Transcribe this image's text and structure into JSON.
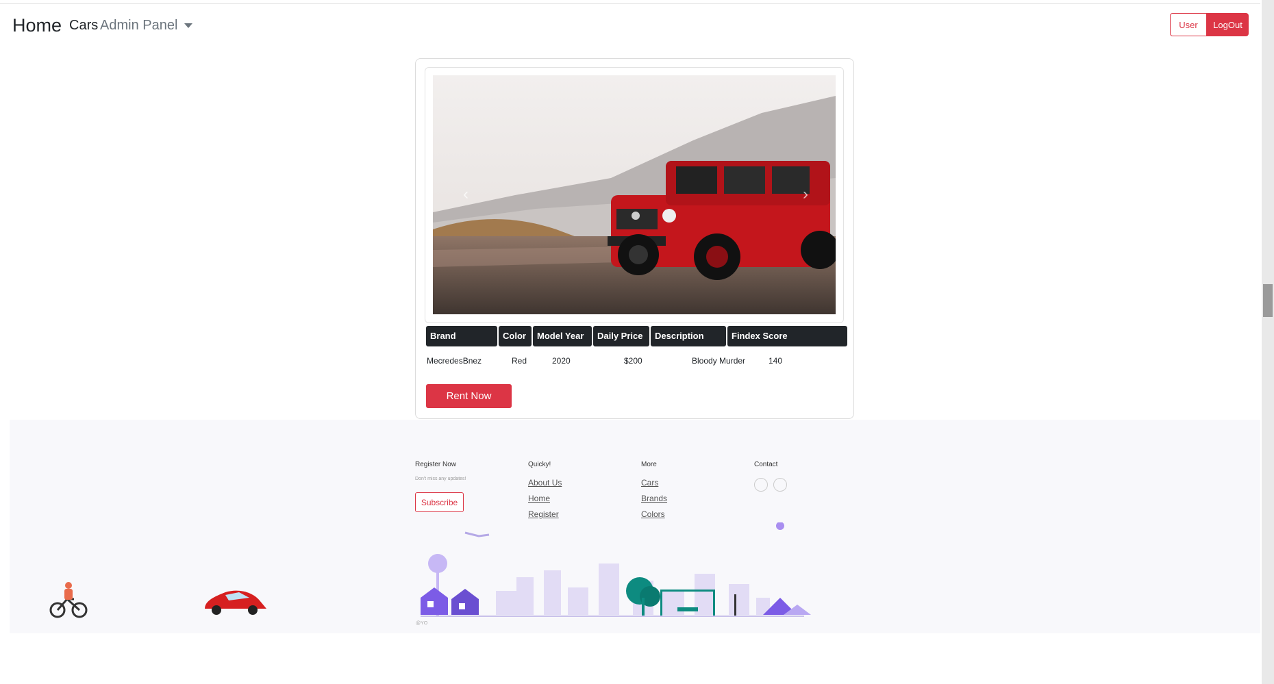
{
  "nav": {
    "brand": "Home",
    "cars": "Cars",
    "admin": "Admin Panel",
    "user_button": "User",
    "logout_button": "LogOut"
  },
  "car": {
    "headers": [
      "Brand",
      "Color",
      "Model Year",
      "Daily Price",
      "Description",
      "Findex Score"
    ],
    "values": [
      "MecredesBnez",
      "Red",
      "2020",
      "$200",
      "Bloody Murder",
      "140"
    ],
    "rent_button": "Rent Now",
    "carousel_prev": "‹",
    "carousel_next": "›"
  },
  "footer": {
    "register_title": "Register Now",
    "register_sub": "Don't miss any updates!",
    "subscribe": "Subscribe",
    "quick_title": "Quicky!",
    "quick_links": [
      "About Us",
      "Home",
      "Register"
    ],
    "more_title": "More",
    "more_links": [
      "Cars",
      "Brands",
      "Colors"
    ],
    "contact_title": "Contact",
    "contact_icons": [
      "",
      ""
    ],
    "copyright": "@YO"
  },
  "colors": {
    "accent": "#dc3545",
    "dark": "#212529",
    "footer_bg": "#f8f8fb",
    "city": "#e2dcf5",
    "purple": "#7c5ce6",
    "teal": "#0d8b80"
  }
}
